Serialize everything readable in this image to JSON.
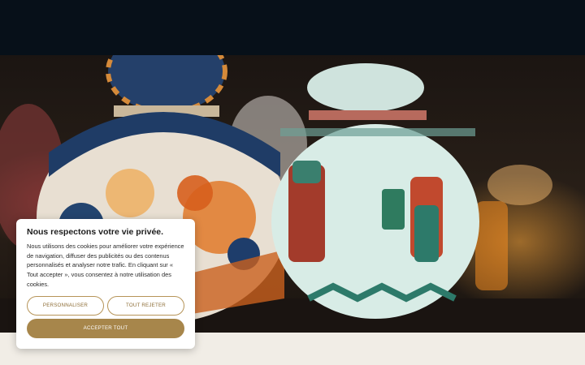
{
  "cookie_banner": {
    "title": "Nous respectons votre vie privée.",
    "body": "Nous utilisons des cookies pour améliorer votre expérience de navigation, diffuser des publicités ou des contenus personnalisés et analyser notre trafic. En cliquant sur « Tout accepter », vous consentez à notre utilisation des cookies.",
    "customize_label": "PERSONNALISER",
    "reject_label": "TOUT REJETER",
    "accept_label": "ACCEPTER TOUT"
  },
  "colors": {
    "topbar": "#071019",
    "accent": "#a7864b",
    "page_background": "#f1ede6"
  }
}
